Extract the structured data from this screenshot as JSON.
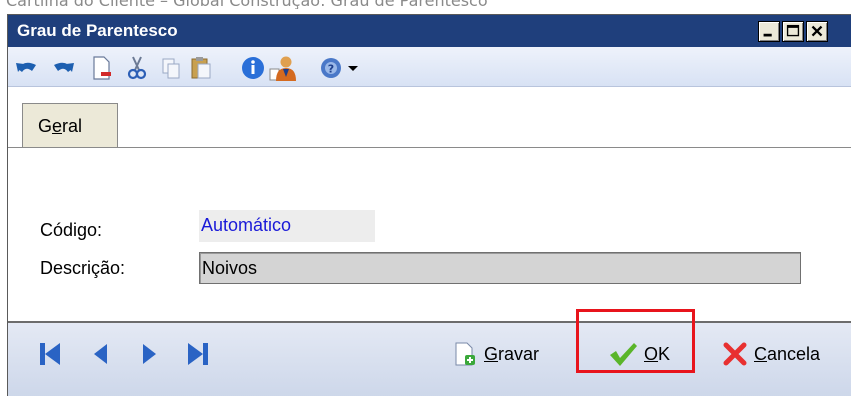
{
  "document": {
    "caption": "Cartilha do Cliente – Global Construção: Grau de Parentesco"
  },
  "window": {
    "title": "Grau de Parentesco",
    "controls": [
      "minimize",
      "maximize",
      "close"
    ]
  },
  "toolbar": {
    "icons": [
      "undo-icon",
      "redo-icon",
      "new-document-icon",
      "cut-icon",
      "copy-icon",
      "paste-icon",
      "info-icon",
      "user-icon",
      "help-icon",
      "dropdown-arrow-icon"
    ]
  },
  "tabs": [
    {
      "label": "Geral",
      "accel": "e",
      "pre": "G",
      "post": "ral",
      "active": true
    }
  ],
  "form": {
    "codigo_label": "Código:",
    "codigo_value": "Automático",
    "descricao_label": "Descrição:",
    "descricao_value": "Noivos"
  },
  "footer": {
    "nav": [
      "first-record-icon",
      "previous-record-icon",
      "next-record-icon",
      "last-record-icon"
    ],
    "gravar": {
      "pre": "",
      "accel": "G",
      "post": "ravar"
    },
    "ok": {
      "pre": "",
      "accel": "O",
      "post": "K"
    },
    "cancela": {
      "pre": "",
      "accel": "C",
      "post": "ancela"
    }
  },
  "colors": {
    "titlebar": "#1f3f7c",
    "highlight": "#e8141c",
    "readonly_text": "#1a1ad8"
  }
}
